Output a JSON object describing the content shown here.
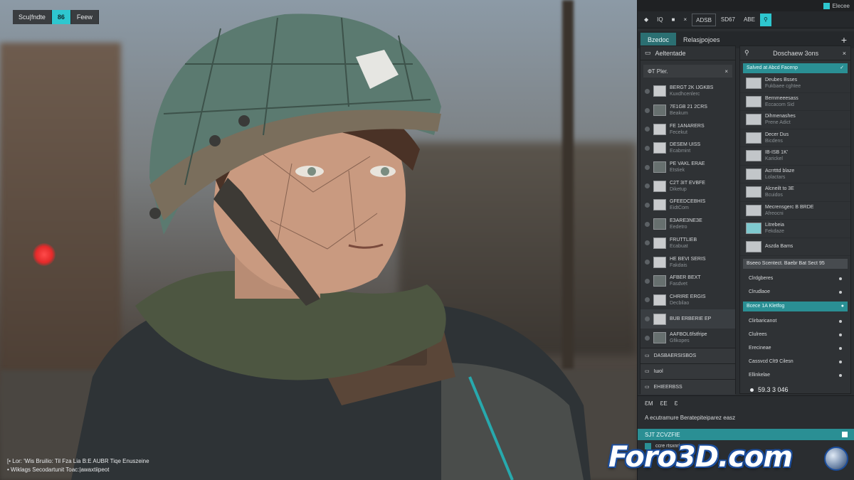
{
  "viewport": {
    "toolbar": [
      "Scu|fndte",
      "86",
      "Feew"
    ],
    "status": [
      "[• Lor: 'Wis Bruilio: Til Fza Lia B:E AUBR Tiqe Enuszeine",
      "• Wiklags Secodartunit Toac:|awaxtiipeot"
    ]
  },
  "topbar": {
    "title": "Elecee"
  },
  "menu": [
    "IQ",
    "■",
    "×",
    "ADSB",
    "SD67",
    "ABE",
    "⚲"
  ],
  "tabs": {
    "items": [
      "Bzedoc",
      "Relasjpojoes"
    ],
    "add": "+"
  },
  "asset_list": {
    "header": "Aeltentade",
    "search": {
      "value": "ФТ Pler.",
      "clear": "×"
    },
    "items": [
      {
        "title": "BERGT 2K IJGKBS",
        "sub": "Kuxdhcenlerc"
      },
      {
        "title": "7E1GB 21 2CRS",
        "sub": "Beakum"
      },
      {
        "title": "FE 1ANARERS",
        "sub": "Fecekut"
      },
      {
        "title": "DESEM UISS",
        "sub": "Ecabmint"
      },
      {
        "title": "PE VAKL ERAE",
        "sub": "Etstiek"
      },
      {
        "title": "C2T 3IT EVBFE",
        "sub": "Diketup"
      },
      {
        "title": "GFEEDCEBHIS",
        "sub": "EidtCom"
      },
      {
        "title": "ЕЗАRЕЗNEЗE",
        "sub": "Eedetro"
      },
      {
        "title": "FRUTTLIEB",
        "sub": "Ecabuat"
      },
      {
        "title": "HE BEVI SERIS",
        "sub": "Fakdais"
      },
      {
        "title": "AFBER BEXT",
        "sub": "Fasdvet"
      },
      {
        "title": "CHRIRE ERGIS",
        "sub": "Decbilao"
      },
      {
        "title": "BUB ERBERIE EP",
        "sub": ""
      },
      {
        "title": "AAFBOL6fstfripe",
        "sub": "Gfikopes"
      }
    ],
    "footer_items": [
      "DASBAERSISBOS",
      "Iшol",
      "EHIEERBSS"
    ]
  },
  "properties": {
    "header": "Doschaew 3ons",
    "highlight": "Salved at Abcd Facenp",
    "items": [
      {
        "title": "Deubes Bsses",
        "sub": "Fukbaee cghtee"
      },
      {
        "title": "Bernmeeesass",
        "sub": "Eccacom Sid"
      },
      {
        "title": "Dihmenashes",
        "sub": "Prene Adict"
      },
      {
        "title": "Decer Dus",
        "sub": "Bicdens"
      },
      {
        "title": "IB-ISB 1K'",
        "sub": "Karickel"
      },
      {
        "title": "Acrrtttd blaze",
        "sub": "Lolactars"
      },
      {
        "title": "Alcneilt to 3E",
        "sub": "Bcuidos"
      },
      {
        "title": "Mecrensgerc B BRDE",
        "sub": "Afreocni"
      },
      {
        "title": "Litrebeia",
        "sub": "Fekdaze"
      },
      {
        "title": "Aszda Bams",
        "sub": ""
      }
    ],
    "section1": "Bseeo Scentect. Baebr Bat Sect 95",
    "options1": [
      "Clrdgberes",
      "Clrudlaoe"
    ],
    "section2": "Bcece 1A Kletfog",
    "options2": [
      "Clirbaricanot",
      "Clulrees",
      "Erecineae",
      "Cassvcd Clt9 Cilesn",
      "Ellinkelae"
    ],
    "value": "59.3 3 046"
  },
  "bottom": {
    "row1": [
      "ƐM",
      "ƐE",
      "Ɛ"
    ],
    "row2": "A ecutramure  Beratepiteiparez easz",
    "teal_bar": "SJT  ZCVZFIE",
    "line": "ccre rtsxnrjatcm"
  },
  "watermark": "Foro3D.com",
  "colors": {
    "accent": "#2ec7cf",
    "accent_dark": "#2a8f94",
    "panel_bg": "#2f3235"
  }
}
